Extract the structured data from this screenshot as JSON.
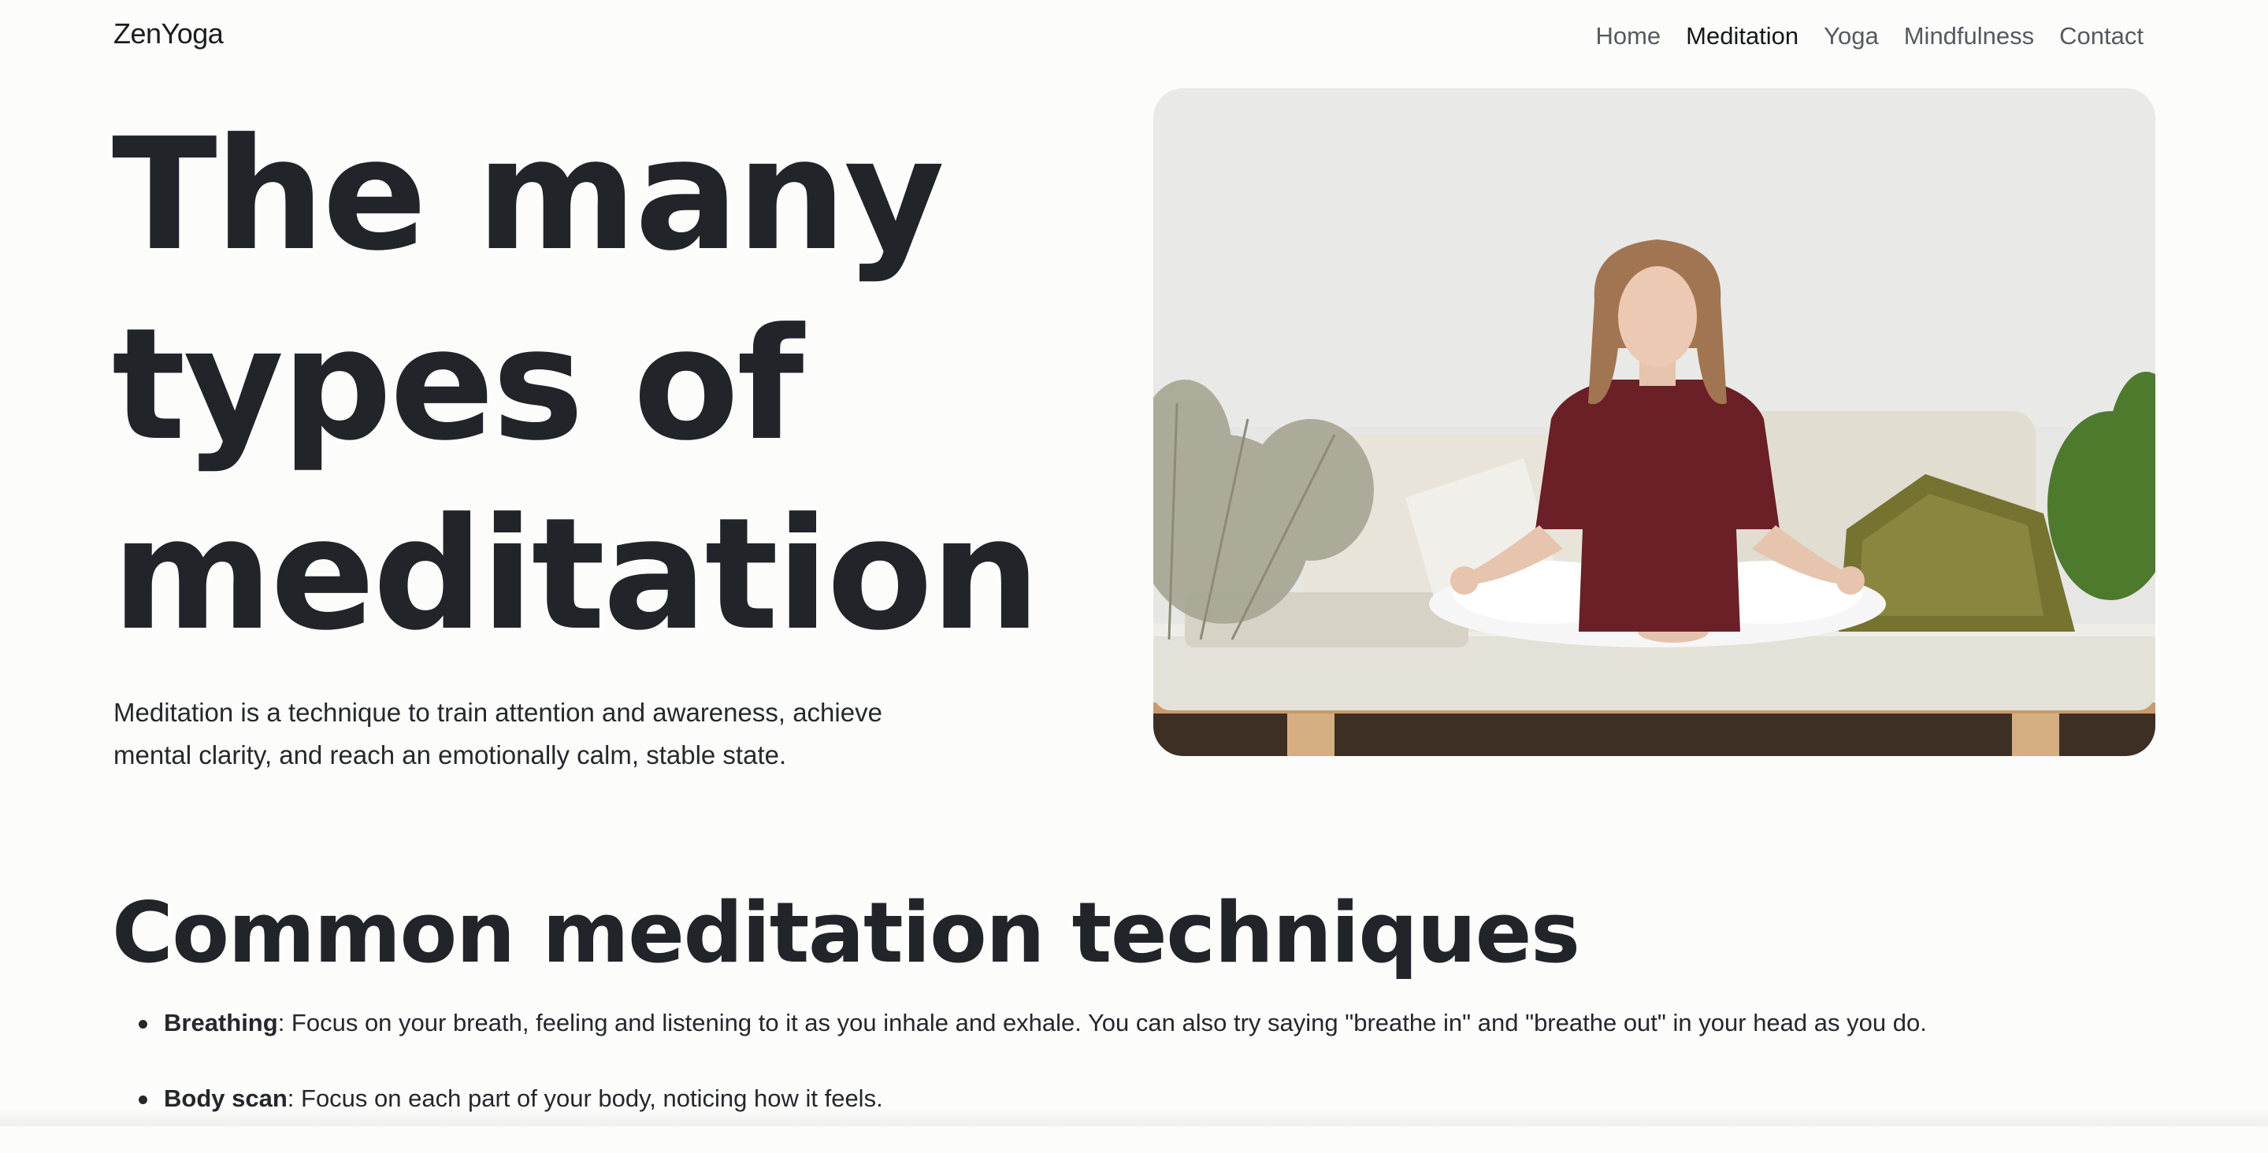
{
  "nav": {
    "brand": "ZenYoga",
    "links": [
      {
        "label": "Home",
        "active": false
      },
      {
        "label": "Meditation",
        "active": true
      },
      {
        "label": "Yoga",
        "active": false
      },
      {
        "label": "Mindfulness",
        "active": false
      },
      {
        "label": "Contact",
        "active": false
      }
    ]
  },
  "hero": {
    "title": "The many types of meditation",
    "description": "Meditation is a technique to train attention and awareness, achieve mental clarity, and reach an emotionally calm, stable state."
  },
  "techniques": {
    "heading": "Common meditation techniques",
    "items": [
      {
        "name": "Breathing",
        "text": ": Focus on your breath, feeling and listening to it as you inhale and exhale. You can also try saying \"breathe in\" and \"breathe out\" in your head as you do."
      },
      {
        "name": "Body scan",
        "text": ": Focus on each part of your body, noticing how it feels."
      }
    ]
  },
  "colors": {
    "background": "#fcfdfb",
    "text": "#212429",
    "nav_muted": "#555a60",
    "shirt": "#6a2026",
    "pillow_olive": "#76722f"
  }
}
